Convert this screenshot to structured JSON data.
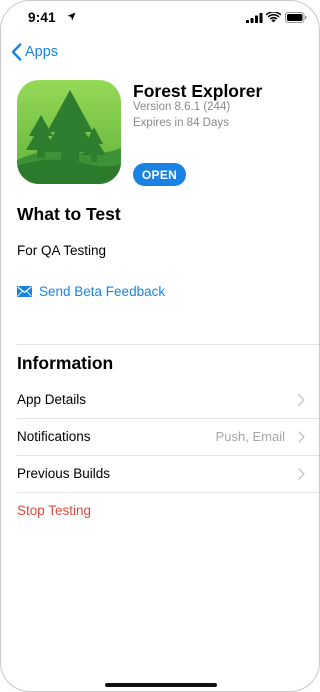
{
  "status_bar": {
    "time": "9:41",
    "icons": [
      "location-arrow-icon",
      "cellular-signal-icon",
      "wifi-icon",
      "battery-icon"
    ]
  },
  "nav": {
    "back_label": "Apps",
    "back_icon": "chevron-left-icon"
  },
  "app": {
    "name": "Forest Explorer",
    "version": "Version 8.6.1 (244)",
    "expires": "Expires in 84 Days",
    "open_label": "OPEN",
    "icon": "forest-app-icon"
  },
  "what_to_test": {
    "title": "What to Test",
    "body": "For QA Testing",
    "feedback_label": "Send Beta Feedback",
    "feedback_icon": "envelope-icon"
  },
  "information": {
    "title": "Information",
    "rows": [
      {
        "label": "App Details",
        "value": ""
      },
      {
        "label": "Notifications",
        "value": "Push, Email"
      },
      {
        "label": "Previous Builds",
        "value": ""
      }
    ],
    "stop_label": "Stop Testing"
  },
  "colors": {
    "accent": "#1a82e2",
    "destructive": "#e0483e",
    "secondary_text": "#8a8a8e",
    "icon_green_light": "#8cd04c",
    "icon_green_dark": "#2f7d2e"
  }
}
